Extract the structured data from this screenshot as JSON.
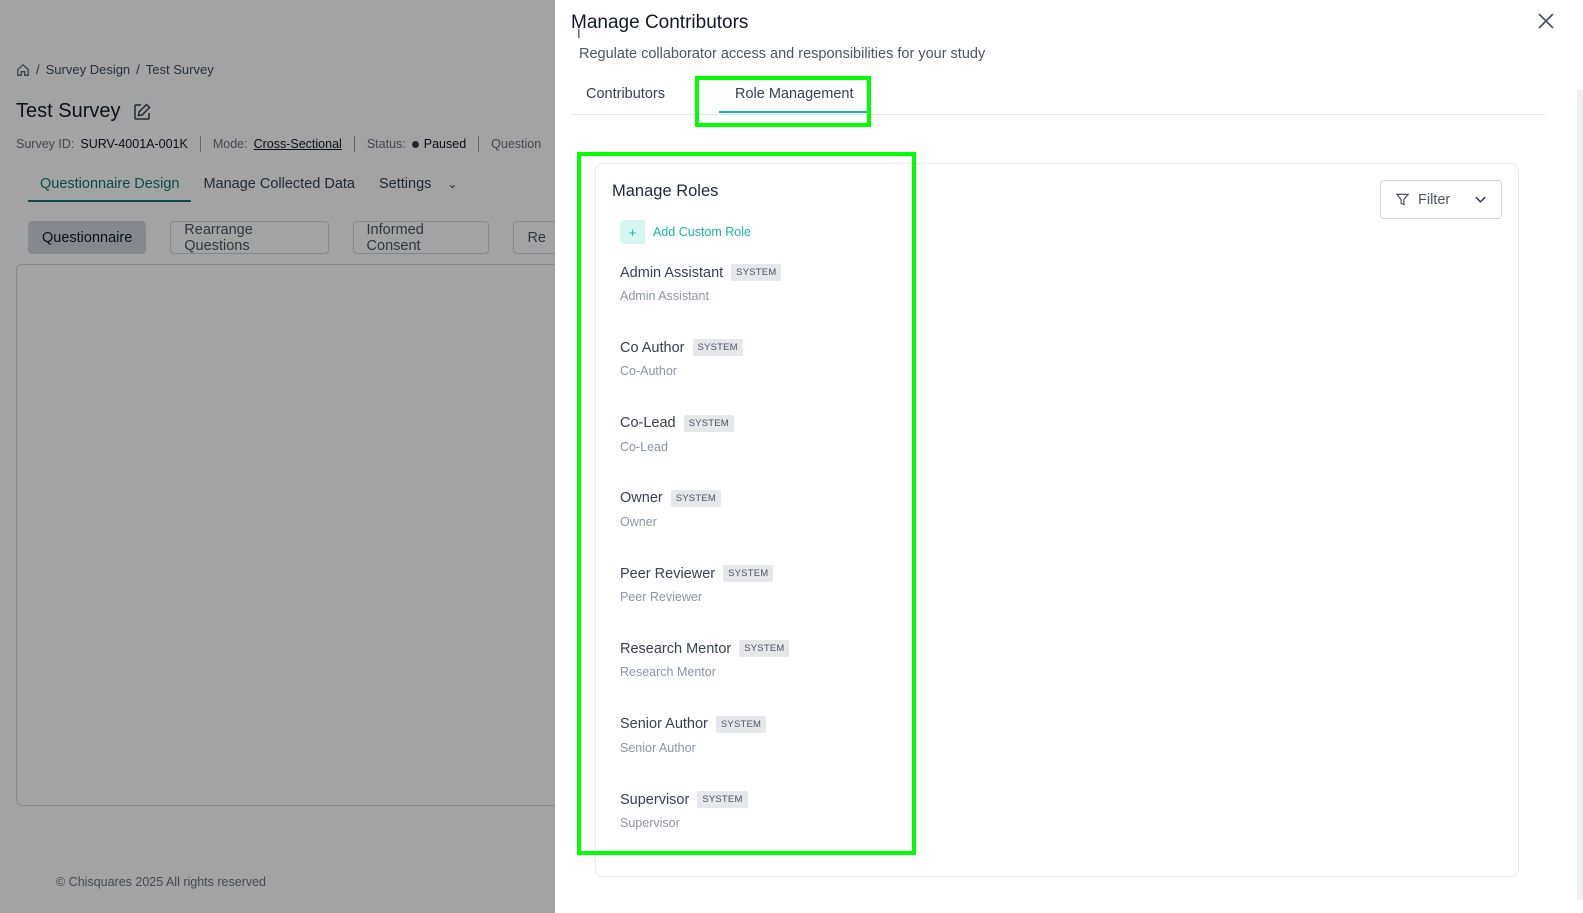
{
  "background": {
    "breadcrumb": [
      "Survey Design",
      "Test Survey"
    ],
    "page_title": "Test Survey",
    "meta": {
      "survey_id_label": "Survey ID:",
      "survey_id": "SURV-4001A-001K",
      "mode_label": "Mode:",
      "mode": "Cross-Sectional",
      "status_label": "Status:",
      "status": "Paused",
      "truncated": "Question"
    },
    "tabs": [
      "Questionnaire Design",
      "Manage Collected Data",
      "Settings"
    ],
    "pills": [
      "Questionnaire",
      "Rearrange Questions",
      "Informed Consent",
      "Re"
    ],
    "footer": "© Chisquares 2025 All rights reserved"
  },
  "drawer": {
    "title": "Manage Contributors",
    "subtitle": "Regulate collaborator access and responsibilities for your study",
    "tabs": {
      "contributors": "Contributors",
      "role_management": "Role Management"
    },
    "card_title": "Manage Roles",
    "add_role_label": "Add Custom Role",
    "filter_label": "Filter",
    "roles": [
      {
        "name": "Admin Assistant",
        "badge": "SYSTEM",
        "desc": "Admin Assistant"
      },
      {
        "name": "Co Author",
        "badge": "SYSTEM",
        "desc": "Co-Author"
      },
      {
        "name": "Co-Lead",
        "badge": "SYSTEM",
        "desc": "Co-Lead"
      },
      {
        "name": "Owner",
        "badge": "SYSTEM",
        "desc": "Owner"
      },
      {
        "name": "Peer Reviewer",
        "badge": "SYSTEM",
        "desc": "Peer Reviewer"
      },
      {
        "name": "Research Mentor",
        "badge": "SYSTEM",
        "desc": "Research Mentor"
      },
      {
        "name": "Senior Author",
        "badge": "SYSTEM",
        "desc": "Senior Author"
      },
      {
        "name": "Supervisor",
        "badge": "SYSTEM",
        "desc": "Supervisor"
      }
    ]
  },
  "colors": {
    "accent": "#14b8a6",
    "highlight": "#00ff00"
  }
}
